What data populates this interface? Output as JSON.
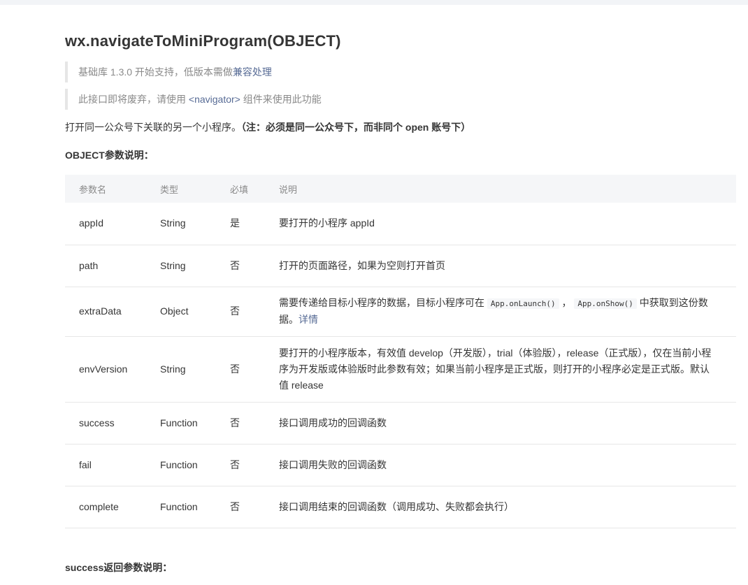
{
  "api": {
    "title": "wx.navigateToMiniProgram(OBJECT)"
  },
  "notes": {
    "version_prefix": "基础库 1.3.0 开始支持，低版本需做",
    "version_link": "兼容处理",
    "deprecated_prefix": "此接口即将废弃，请使用 ",
    "deprecated_tag": "<navigator>",
    "deprecated_suffix": " 组件来使用此功能"
  },
  "description": {
    "text": "打开同一公众号下关联的另一个小程序。",
    "note": "（注：必须是同一公众号下，而非同个 open 账号下）"
  },
  "object_section": {
    "title": "OBJECT参数说明："
  },
  "table": {
    "headers": [
      "参数名",
      "类型",
      "必填",
      "说明"
    ],
    "rows": [
      {
        "name": "appId",
        "type": "String",
        "required": "是",
        "desc": "要打开的小程序 appId"
      },
      {
        "name": "path",
        "type": "String",
        "required": "否",
        "desc": "打开的页面路径，如果为空则打开首页"
      },
      {
        "name": "extraData",
        "type": "Object",
        "required": "否",
        "desc_prefix": "需要传递给目标小程序的数据，目标小程序可在 ",
        "code1": "App.onLaunch()",
        "desc_sep": " ， ",
        "code2": "App.onShow()",
        "desc_suffix": " 中获取到这份数据。",
        "link": "详情"
      },
      {
        "name": "envVersion",
        "type": "String",
        "required": "否",
        "desc": "要打开的小程序版本，有效值 develop（开发版），trial（体验版），release（正式版），仅在当前小程序为开发版或体验版时此参数有效；如果当前小程序是正式版，则打开的小程序必定是正式版。默认值 release"
      },
      {
        "name": "success",
        "type": "Function",
        "required": "否",
        "desc": "接口调用成功的回调函数"
      },
      {
        "name": "fail",
        "type": "Function",
        "required": "否",
        "desc": "接口调用失败的回调函数"
      },
      {
        "name": "complete",
        "type": "Function",
        "required": "否",
        "desc": "接口调用结束的回调函数（调用成功、失败都会执行）"
      }
    ]
  },
  "success_section": {
    "title": "success返回参数说明："
  }
}
